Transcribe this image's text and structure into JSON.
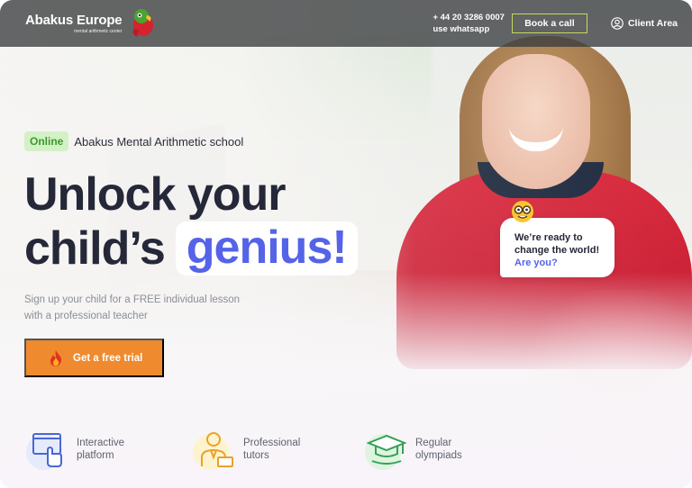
{
  "header": {
    "brand": "Abakus Europe",
    "brand_sub": "mental arithmetic center",
    "phone": "+ 44 20 3286 0007",
    "whatsapp": "use whatsapp",
    "book_call": "Book a call",
    "client_area": "Client Area"
  },
  "hero": {
    "badge": "Online",
    "school": "Abakus Mental Arithmetic school",
    "headline_line1": "Unlock your",
    "headline_line2_prefix": "child’s",
    "headline_highlight": "genius!",
    "subtitle": "Sign up your child for a FREE individual lesson with a professional teacher",
    "cta": "Get a free trial"
  },
  "bubble": {
    "line1": "We’re ready to",
    "line2": "change the world!",
    "line3": "Are you?"
  },
  "features": [
    {
      "icon": "interactive-platform-icon",
      "label_line1": "Interactive",
      "label_line2": "platform"
    },
    {
      "icon": "tutor-icon",
      "label_line1": "Professional",
      "label_line2": "tutors"
    },
    {
      "icon": "graduation-cap-icon",
      "label_line1": "Regular",
      "label_line2": "olympiads"
    }
  ],
  "colors": {
    "accent": "#5563e8",
    "cta": "#ef8a2f",
    "online_badge_bg": "#d4f0c6",
    "online_badge_text": "#3a9b2b",
    "book_border": "#c7d85a",
    "header_bg": "#3a3c3e"
  }
}
